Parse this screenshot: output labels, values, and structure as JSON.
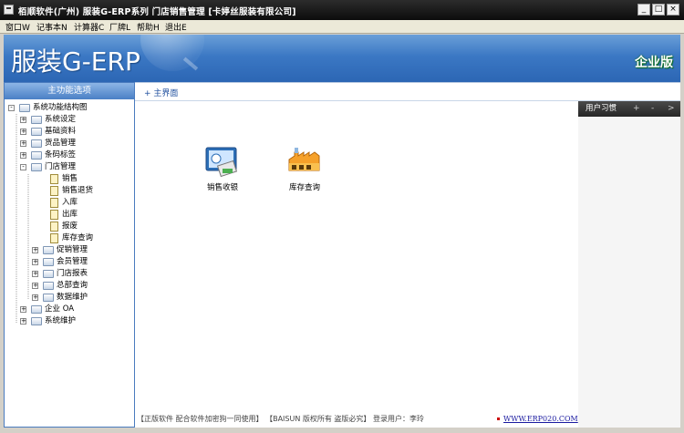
{
  "window": {
    "title": "栢顺软件(广州) 服装G-ERP系列 门店销售管理 [卡婷丝服装有限公司]",
    "min_glyph": "_",
    "max_glyph": "□",
    "close_glyph": "×"
  },
  "menu": [
    {
      "label": "窗口W"
    },
    {
      "label": "记事本N"
    },
    {
      "label": "计算器C"
    },
    {
      "label": "厂牌L"
    },
    {
      "label": "帮助H"
    },
    {
      "label": "退出E"
    }
  ],
  "banner": {
    "logo": "服装G-ERP",
    "edition": "企业版"
  },
  "left_panel": {
    "header": "主功能选项",
    "tree": [
      {
        "label": "系统功能结构图",
        "level": 0,
        "type": "folder",
        "exp": "-"
      },
      {
        "label": "系统设定",
        "level": 1,
        "type": "folder",
        "exp": "+"
      },
      {
        "label": "基础资料",
        "level": 1,
        "type": "folder",
        "exp": "+"
      },
      {
        "label": "货品管理",
        "level": 1,
        "type": "folder",
        "exp": "+"
      },
      {
        "label": "条码标签",
        "level": 1,
        "type": "folder",
        "exp": "+"
      },
      {
        "label": "门店管理",
        "level": 1,
        "type": "folder",
        "exp": "-"
      },
      {
        "label": "销售",
        "level": 2,
        "type": "doc"
      },
      {
        "label": "销售退货",
        "level": 2,
        "type": "doc"
      },
      {
        "label": "入库",
        "level": 2,
        "type": "doc"
      },
      {
        "label": "出库",
        "level": 2,
        "type": "doc"
      },
      {
        "label": "报废",
        "level": 2,
        "type": "doc"
      },
      {
        "label": "库存查询",
        "level": 2,
        "type": "doc"
      },
      {
        "label": "促销管理",
        "level": 2,
        "type": "folder",
        "exp": "+"
      },
      {
        "label": "会员管理",
        "level": 2,
        "type": "folder",
        "exp": "+"
      },
      {
        "label": "门店报表",
        "level": 2,
        "type": "folder",
        "exp": "+"
      },
      {
        "label": "总部查询",
        "level": 2,
        "type": "folder",
        "exp": "+"
      },
      {
        "label": "数据维护",
        "level": 2,
        "type": "folder",
        "exp": "+"
      },
      {
        "label": "企业 OA",
        "level": 1,
        "type": "folder",
        "exp": "+"
      },
      {
        "label": "系统维护",
        "level": 1,
        "type": "folder",
        "exp": "+"
      }
    ]
  },
  "main": {
    "tab": "+ 主界面",
    "shortcuts": [
      {
        "label": "销售收银",
        "icon": "pos-terminal-icon"
      },
      {
        "label": "库存查询",
        "icon": "warehouse-icon"
      }
    ]
  },
  "right_panel": {
    "header": "用户习惯",
    "buttons": [
      "+",
      "-",
      ">"
    ]
  },
  "status": {
    "text": "【正版软件 配合软件加密狗一同使用】 【BAISUN 版权所有 盗版必究】 登录用户：李玲",
    "link": "WWW.ERP020.COM"
  }
}
